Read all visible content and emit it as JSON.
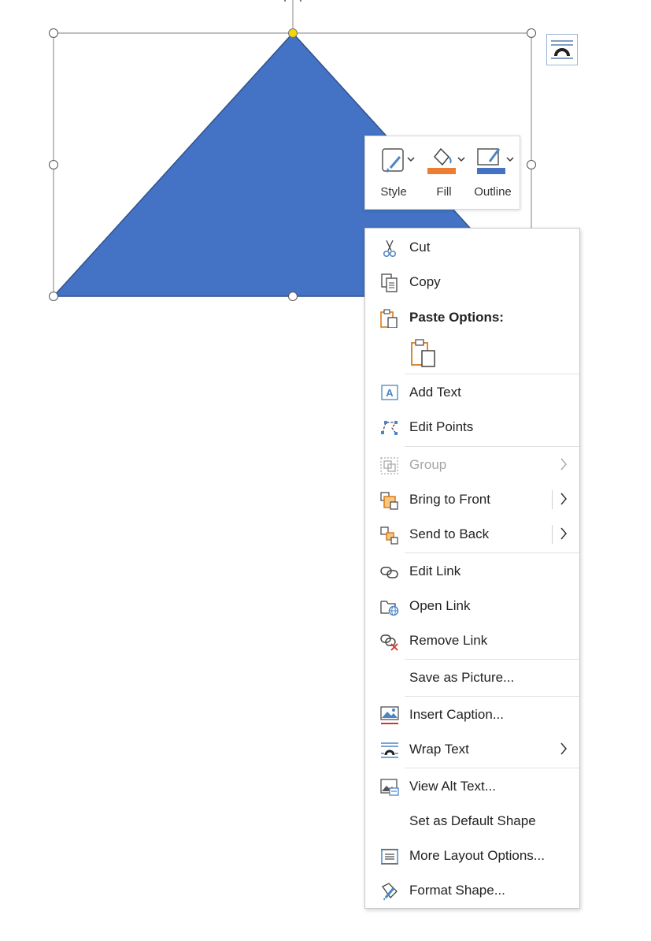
{
  "mini_toolbar": {
    "style_label": "Style",
    "fill_label": "Fill",
    "outline_label": "Outline"
  },
  "colors": {
    "shape_fill": "#4472c4",
    "shape_stroke": "#2f528f",
    "fill_bar": "#ed7d31",
    "outline_bar": "#4472c4",
    "adjust_handle": "#f5d60a"
  },
  "context_menu": {
    "cut": "Cut",
    "copy": "Copy",
    "paste_options": "Paste Options:",
    "add_text": "Add Text",
    "edit_points": "Edit Points",
    "group": "Group",
    "bring_to_front": "Bring to Front",
    "send_to_back": "Send to Back",
    "edit_link": "Edit Link",
    "open_link": "Open Link",
    "remove_link": "Remove Link",
    "save_as_picture": "Save as Picture...",
    "insert_caption": "Insert Caption...",
    "wrap_text": "Wrap Text",
    "view_alt_text": "View Alt Text...",
    "set_default_shape": "Set as Default Shape",
    "more_layout_options": "More Layout Options...",
    "format_shape": "Format Shape..."
  },
  "icons": {
    "layout_options": "layout-options-icon",
    "rotate": "rotate-handle-icon",
    "cut": "scissors-icon",
    "copy": "copy-icon",
    "paste": "clipboard-icon",
    "add_text": "text-box-icon",
    "edit_points": "edit-points-icon",
    "group": "group-icon",
    "bring_front": "bring-to-front-icon",
    "send_back": "send-to-back-icon",
    "edit_link": "link-icon",
    "open_link": "open-link-icon",
    "remove_link": "remove-link-icon",
    "insert_caption": "caption-icon",
    "wrap_text": "wrap-text-icon",
    "alt_text": "alt-text-icon",
    "layout_more": "layout-icon",
    "format_shape": "format-shape-icon"
  }
}
